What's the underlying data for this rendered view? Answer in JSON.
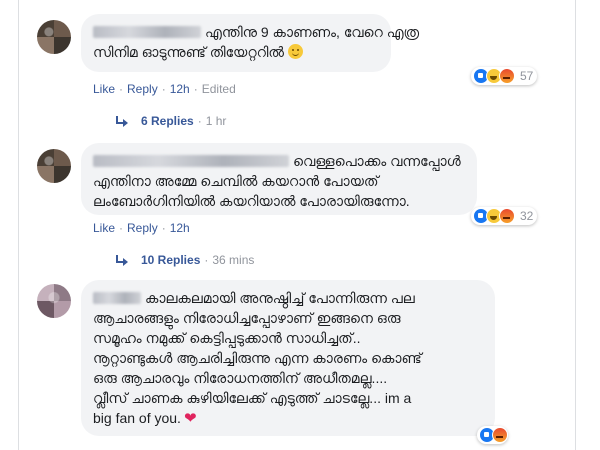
{
  "comments": [
    {
      "lines": [
        "എന്തിനു 9 കാണണം, വേറെ എത്ര",
        "സിനിമ ഓടുന്നുണ്ട് തിയേറ്ററിൽ"
      ],
      "emoji": "smile-wink-emoji",
      "actions": {
        "like": "Like",
        "reply": "Reply",
        "time": "12h",
        "edited": "Edited"
      },
      "reactions": {
        "icons": [
          "like",
          "haha",
          "angry"
        ],
        "count": "57"
      },
      "replies": {
        "label": "6 Replies",
        "time": "1 hr"
      }
    },
    {
      "lines": [
        "വെള്ളപൊക്കം വന്നപ്പോൾ",
        "എന്തിനാ അമ്മേ ചെമ്പിൽ കയറാൻ പോയത്",
        "ലംബോർഗിനിയിൽ കയറിയാൽ പോരായിരുന്നോ."
      ],
      "actions": {
        "like": "Like",
        "reply": "Reply",
        "time": "12h"
      },
      "reactions": {
        "icons": [
          "like",
          "haha",
          "angry"
        ],
        "count": "32"
      },
      "replies": {
        "label": "10 Replies",
        "time": "36 mins"
      }
    },
    {
      "lines": [
        "കാലകലമായി അനുഷ്ഠിച്ച് പോന്നിരുന്ന പല",
        "ആചാരങ്ങളും നിരോധിച്ചപ്പോഴാണ് ഇങ്ങനെ ഒരു",
        "സമൂഹം നമുക്ക് കെട്ടിപ്പടുക്കാൻ സാധിച്ചത്..",
        "നൂറ്റാണ്ടുകൾ ആചരിച്ചിരുന്നു എന്ന കാരണം കൊണ്ട്",
        "ഒരു ആചാരവും നിരോധനത്തിന് അധീതമല്ല....",
        "വ്ലീസ് ചാണക കുഴിയിലേക്ക് എടുത്ത് ചാടല്ലേ... im a",
        "big fan of you."
      ],
      "reactions": {
        "icons": [
          "like",
          "angry"
        ]
      }
    }
  ],
  "colors": {
    "link": "#385898",
    "bubble": "#f2f3f5",
    "heart": "#e0245e"
  }
}
